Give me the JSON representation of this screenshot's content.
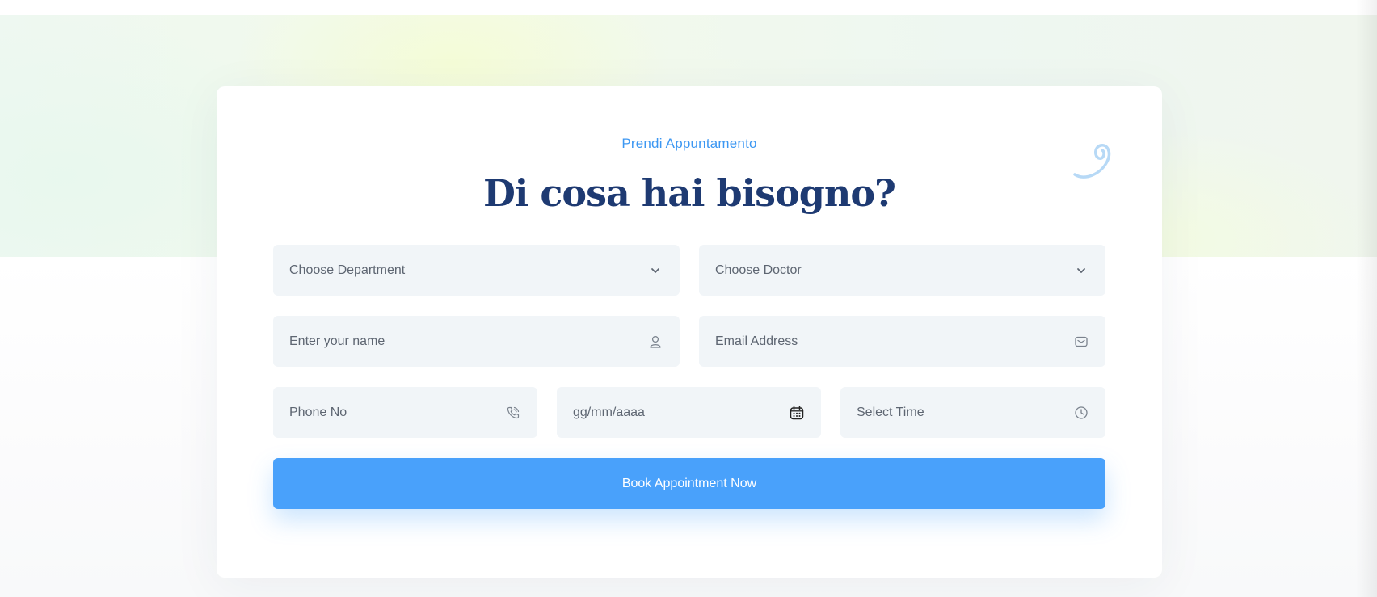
{
  "section": {
    "eyebrow": "Prendi Appuntamento",
    "title": "Di cosa hai bisogno?"
  },
  "form": {
    "department": {
      "placeholder": "Choose Department",
      "icon": "chevron-down-icon"
    },
    "doctor": {
      "placeholder": "Choose Doctor",
      "icon": "chevron-down-icon"
    },
    "name": {
      "placeholder": "Enter your name",
      "icon": "user-icon"
    },
    "email": {
      "placeholder": "Email Address",
      "icon": "envelope-icon"
    },
    "phone": {
      "placeholder": "Phone No",
      "icon": "phone-icon"
    },
    "date": {
      "placeholder": "gg/mm/aaaa",
      "icon": "calendar-icon"
    },
    "time": {
      "placeholder": "Select Time",
      "icon": "clock-icon"
    },
    "submit_label": "Book Appointment Now"
  },
  "colors": {
    "accent": "#49a1fb",
    "eyebrow": "#3c97f2",
    "title": "#1e3a72",
    "field_bg": "#f1f5f8",
    "field_text": "#5e6672"
  }
}
